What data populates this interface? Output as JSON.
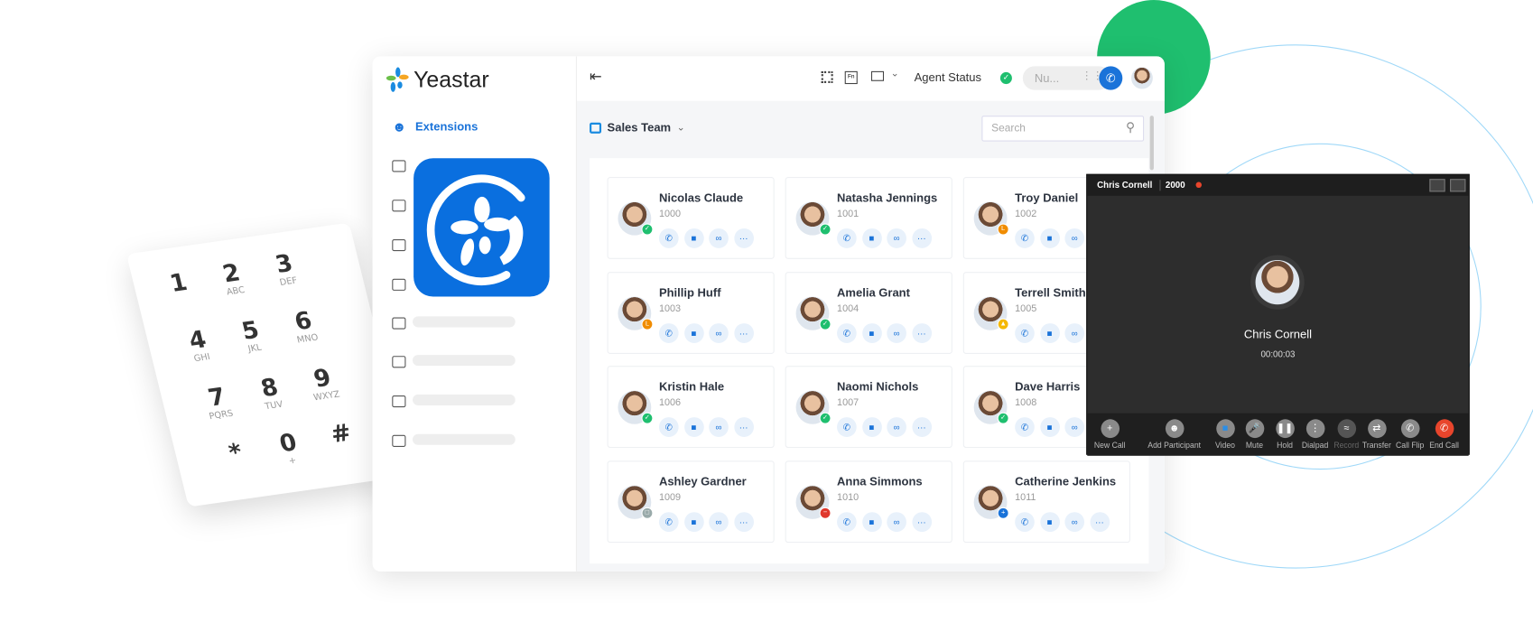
{
  "brand": {
    "name": "Yeastar"
  },
  "colors": {
    "accent": "#1a73d9",
    "green": "#1fbf6f",
    "app_icon": "#0a6fdf",
    "call_bg": "#2d2d2d",
    "end_call": "#e8452c"
  },
  "keypad": [
    {
      "d": "1",
      "l": ""
    },
    {
      "d": "2",
      "l": "ABC"
    },
    {
      "d": "3",
      "l": "DEF"
    },
    {
      "d": "4",
      "l": "GHI"
    },
    {
      "d": "5",
      "l": "JKL"
    },
    {
      "d": "6",
      "l": "MNO"
    },
    {
      "d": "7",
      "l": "PQRS"
    },
    {
      "d": "8",
      "l": "TUV"
    },
    {
      "d": "9",
      "l": "WXYZ"
    },
    {
      "d": "*",
      "l": ""
    },
    {
      "d": "0",
      "l": "+"
    },
    {
      "d": "#",
      "l": ""
    }
  ],
  "sidebar": {
    "active_label": "Extensions",
    "icons": [
      "contacts-icon",
      "conference-icon",
      "monitor-icon",
      "headset-icon",
      "report-icon",
      "voicemail-icon",
      "microphone-icon",
      "settings-list-icon"
    ]
  },
  "header": {
    "agent_status": "Agent Status",
    "number_placeholder": "Nu...",
    "icons": [
      "qr-code-icon",
      "fn-key-icon",
      "desktop-icon"
    ]
  },
  "toolbar": {
    "group": "Sales Team",
    "search_placeholder": "Search"
  },
  "extensions": [
    {
      "name": "Nicolas Claude",
      "ext": "1000",
      "status": "available"
    },
    {
      "name": "Natasha Jennings",
      "ext": "1001",
      "status": "available"
    },
    {
      "name": "Troy Daniel",
      "ext": "1002",
      "status": "away"
    },
    {
      "name": "Phillip Huff",
      "ext": "1003",
      "status": "away"
    },
    {
      "name": "Amelia Grant",
      "ext": "1004",
      "status": "available"
    },
    {
      "name": "Terrell Smith",
      "ext": "1005",
      "status": "business-trip"
    },
    {
      "name": "Kristin Hale",
      "ext": "1006",
      "status": "available"
    },
    {
      "name": "Naomi Nichols",
      "ext": "1007",
      "status": "available"
    },
    {
      "name": "Dave Harris",
      "ext": "1008",
      "status": "available"
    },
    {
      "name": "Ashley Gardner",
      "ext": "1009",
      "status": "offline"
    },
    {
      "name": "Anna Simmons",
      "ext": "1010",
      "status": "do-not-disturb"
    },
    {
      "name": "Catherine Jenkins",
      "ext": "1011",
      "status": "lunch"
    }
  ],
  "call": {
    "name": "Chris Cornell",
    "ext": "2000",
    "caller": "Chris Cornell",
    "duration": "00:00:03",
    "buttons": [
      "New Call",
      "Add Participant",
      "Video",
      "Mute",
      "Hold",
      "Dialpad",
      "Record",
      "Transfer",
      "Call Flip",
      "End Call"
    ]
  }
}
